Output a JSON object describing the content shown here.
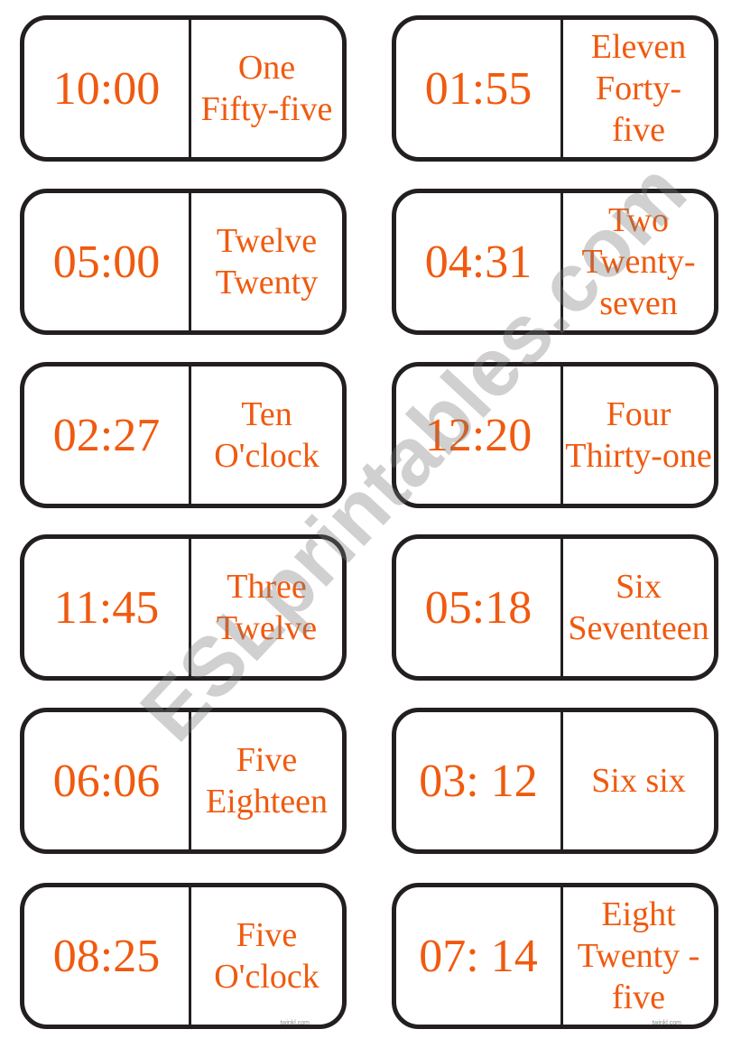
{
  "watermark": "ESLprintables.com",
  "brand": "twinkl.com",
  "cards": [
    {
      "time": "10:00",
      "words": "One\nFifty-five"
    },
    {
      "time": "01:55",
      "words": "Eleven\nForty-\nfive"
    },
    {
      "time": "05:00",
      "words": "Twelve\nTwenty"
    },
    {
      "time": "04:31",
      "words": "Two\nTwenty-\nseven"
    },
    {
      "time": "02:27",
      "words": "Ten\nO'clock"
    },
    {
      "time": "12:20",
      "words": "Four\nThirty-one"
    },
    {
      "time": "11:45",
      "words": "Three\nTwelve"
    },
    {
      "time": "05:18",
      "words": "Six\nSeventeen"
    },
    {
      "time": "06:06",
      "words": "Five\nEighteen"
    },
    {
      "time": "03: 12",
      "words": "Six six"
    },
    {
      "time": "08:25",
      "words": "Five\nO'clock"
    },
    {
      "time": "07: 14",
      "words": "Eight\nTwenty -\nfive"
    }
  ],
  "colors": {
    "text": "#f05a0f",
    "border": "#231f20"
  }
}
